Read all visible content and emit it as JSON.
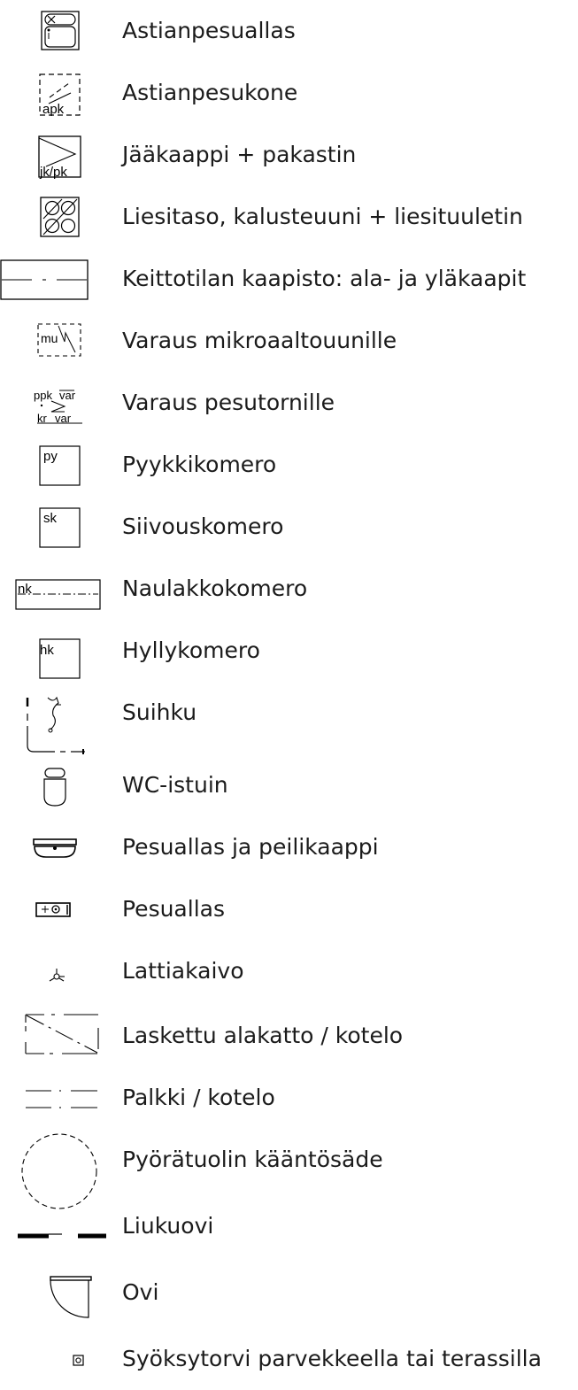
{
  "legend": {
    "items": [
      {
        "label": "Astianpesuallas",
        "symbol": "dish-sink-icon"
      },
      {
        "label": "Astianpesukone",
        "symbol": "dishwasher-icon",
        "symbol_text": "apk"
      },
      {
        "label": "Jääkaappi + pakastin",
        "symbol": "fridge-freezer-icon",
        "symbol_text": "jk/pk"
      },
      {
        "label": "Liesitaso, kalusteuuni + liesituuletin",
        "symbol": "stove-hob-icon"
      },
      {
        "label": "Keittotilan kaapisto: ala- ja yläkaapit",
        "symbol": "kitchen-cabinets-icon"
      },
      {
        "label": "Varaus mikroaaltouunille",
        "symbol": "microwave-reservation-icon",
        "symbol_text": "mu"
      },
      {
        "label": "Varaus pesutornille",
        "symbol": "washing-tower-reservation-icon",
        "symbol_text_a": "ppk",
        "symbol_text_b": "var",
        "symbol_text_c": "kr",
        "symbol_text_d": "var"
      },
      {
        "label": "Pyykkikomero",
        "symbol": "laundry-closet-icon",
        "symbol_text": "py"
      },
      {
        "label": "Siivouskomero",
        "symbol": "cleaning-closet-icon",
        "symbol_text": "sk"
      },
      {
        "label": "Naulakkokomero",
        "symbol": "coat-closet-icon",
        "symbol_text": "nk"
      },
      {
        "label": "Hyllykomero",
        "symbol": "shelf-closet-icon",
        "symbol_text": "hk"
      },
      {
        "label": "Suihku",
        "symbol": "shower-icon"
      },
      {
        "label": "WC-istuin",
        "symbol": "toilet-icon"
      },
      {
        "label": "Pesuallas ja peilikaappi",
        "symbol": "washbasin-mirror-cabinet-icon"
      },
      {
        "label": "Pesuallas",
        "symbol": "washbasin-icon"
      },
      {
        "label": "Lattiakaivo",
        "symbol": "floor-drain-icon"
      },
      {
        "label": "Laskettu alakatto / kotelo",
        "symbol": "lowered-ceiling-icon"
      },
      {
        "label": "Palkki / kotelo",
        "symbol": "beam-casing-icon"
      },
      {
        "label": "Pyörätuolin kääntösäde",
        "symbol": "wheelchair-turning-radius-icon"
      },
      {
        "label": "Liukuovi",
        "symbol": "sliding-door-icon"
      },
      {
        "label": "Ovi",
        "symbol": "door-icon"
      },
      {
        "label": "Syöksytorvi parvekkeella tai terassilla",
        "symbol": "downspout-icon"
      }
    ]
  }
}
